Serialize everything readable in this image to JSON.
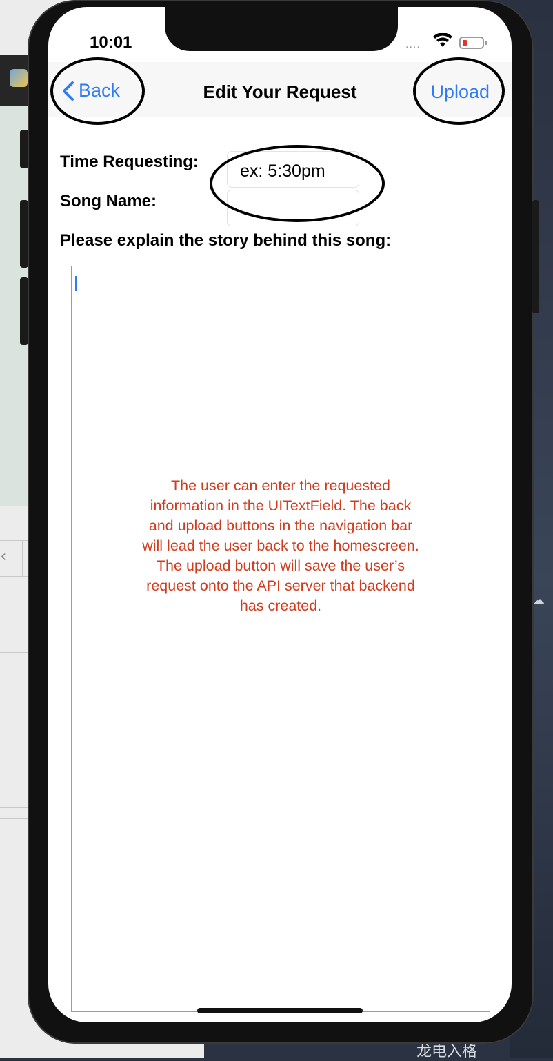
{
  "status_bar": {
    "time": "10:01",
    "signal_dots": "....",
    "battery_color": "#e5322d"
  },
  "nav": {
    "back_label": "Back",
    "title": "Edit Your Request",
    "upload_label": "Upload",
    "tint": "#2f7cf6"
  },
  "form": {
    "time_label": "Time Requesting:",
    "time_placeholder": "ex: 5:30pm",
    "song_label": "Song Name:",
    "song_value": "",
    "story_label": "Please explain the story behind this song:"
  },
  "note": {
    "text": "The user can enter the requested\ninformation in the UITextField. The back\nand upload buttons in the navigation bar\nwill lead the user back to the homescreen.\nThe upload button will save the user’s\nrequest onto the API server that backend\nhas created.",
    "color": "#d23c1e"
  },
  "background": {
    "bottom_text": "龙电入格",
    "chevron": "‹"
  }
}
